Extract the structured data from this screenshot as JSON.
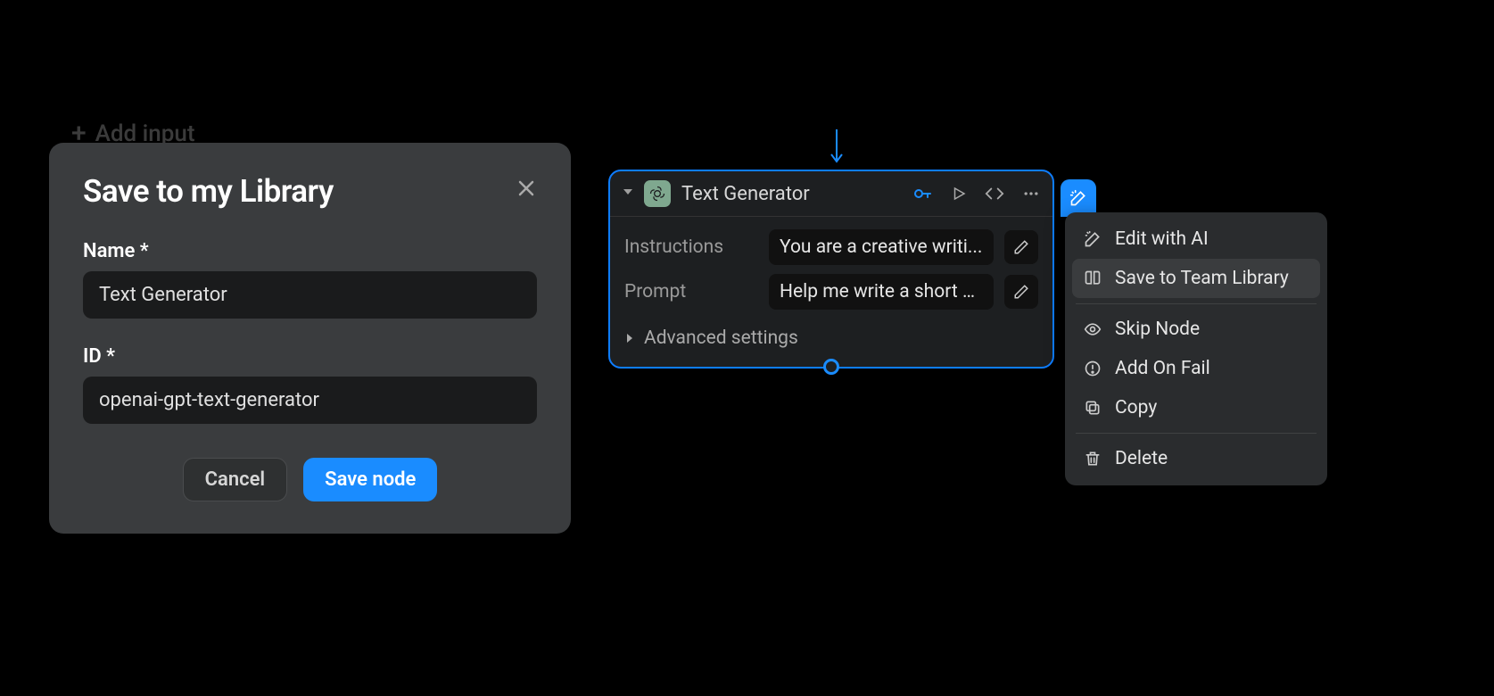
{
  "backgroundHint": {
    "add_input_label": "Add input"
  },
  "modal": {
    "title": "Save to my Library",
    "name_label": "Name *",
    "name_value": "Text Generator",
    "id_label": "ID *",
    "id_value": "openai-gpt-text-generator",
    "cancel_label": "Cancel",
    "save_label": "Save node"
  },
  "node": {
    "title": "Text Generator",
    "fields": {
      "instructions_label": "Instructions",
      "instructions_value": "You are a creative writi...",
      "prompt_label": "Prompt",
      "prompt_value": "Help me write a short s..."
    },
    "advanced_label": "Advanced settings",
    "icons": {
      "collapse": "chevron-down-icon",
      "brand": "openai-icon",
      "key": "key-icon",
      "play": "play-icon",
      "code": "code-icon",
      "more": "more-icon",
      "wand": "wand-icon",
      "pencil": "pencil-icon"
    }
  },
  "contextMenu": {
    "items": [
      {
        "icon": "wand-icon",
        "label": "Edit with AI"
      },
      {
        "icon": "book-icon",
        "label": "Save to Team Library",
        "highlight": true
      }
    ],
    "group2": [
      {
        "icon": "eye-icon",
        "label": "Skip Node"
      },
      {
        "icon": "alert-icon",
        "label": "Add On Fail"
      },
      {
        "icon": "copy-icon",
        "label": "Copy"
      }
    ],
    "group3": [
      {
        "icon": "trash-icon",
        "label": "Delete"
      }
    ]
  }
}
